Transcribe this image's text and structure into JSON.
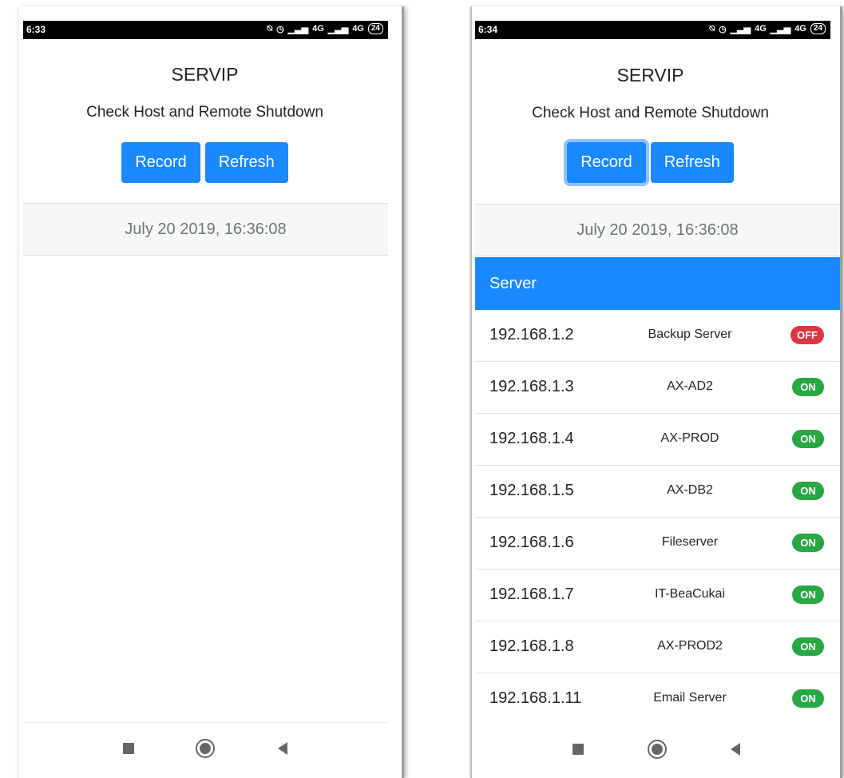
{
  "app": {
    "title": "SERVIP",
    "subtitle": "Check Host and Remote Shutdown",
    "record_label": "Record",
    "refresh_label": "Refresh"
  },
  "screens": {
    "left": {
      "time": "6:33",
      "date": "July 20 2019, 16:36:08"
    },
    "right": {
      "time": "6:34",
      "date": "July 20 2019, 16:36:08"
    }
  },
  "status_icons": {
    "network_1": "4G",
    "network_2": "4G",
    "battery": "24"
  },
  "table": {
    "header": "Server",
    "rows": [
      {
        "ip": "192.168.1.2",
        "name": "Backup Server",
        "status": "OFF"
      },
      {
        "ip": "192.168.1.3",
        "name": "AX-AD2",
        "status": "ON"
      },
      {
        "ip": "192.168.1.4",
        "name": "AX-PROD",
        "status": "ON"
      },
      {
        "ip": "192.168.1.5",
        "name": "AX-DB2",
        "status": "ON"
      },
      {
        "ip": "192.168.1.6",
        "name": "Fileserver",
        "status": "ON"
      },
      {
        "ip": "192.168.1.7",
        "name": "IT-BeaCukai",
        "status": "ON"
      },
      {
        "ip": "192.168.1.8",
        "name": "AX-PROD2",
        "status": "ON"
      },
      {
        "ip": "192.168.1.11",
        "name": "Email Server",
        "status": "ON"
      }
    ]
  },
  "colors": {
    "primary": "#1a88ff",
    "on": "#28a745",
    "off": "#dc3545"
  },
  "icons": {
    "square": "square-nav-icon",
    "home": "home-circle-icon",
    "back": "back-triangle-icon"
  }
}
